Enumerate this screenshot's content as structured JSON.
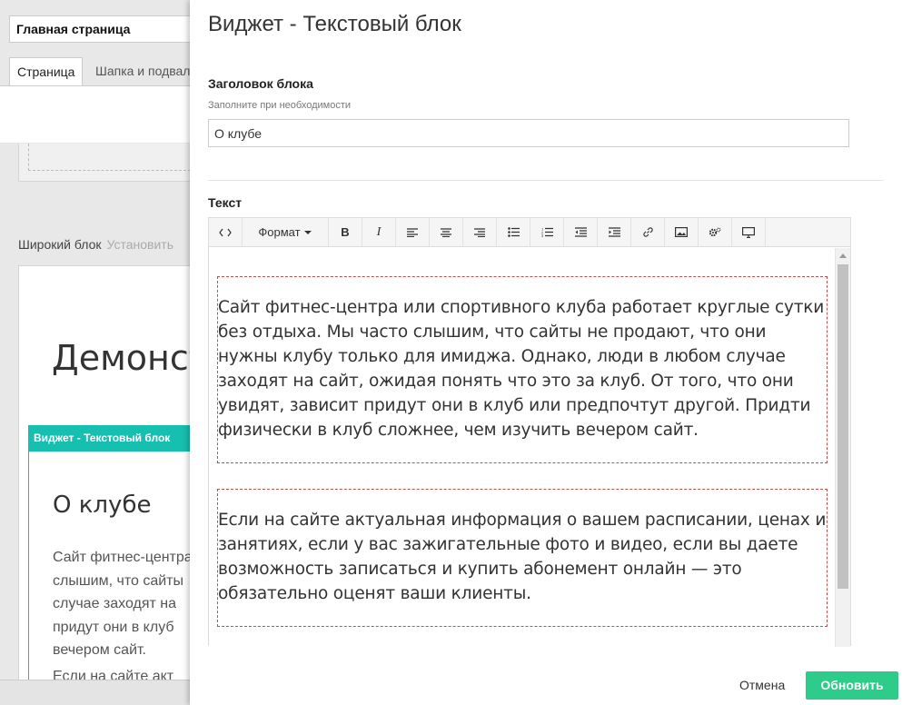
{
  "background": {
    "page_title": "Главная страница",
    "tabs": [
      {
        "label": "Страница"
      },
      {
        "label": "Шапка и подвал"
      }
    ],
    "wide_block": {
      "title": "Широкий блок",
      "hint": "Установить"
    },
    "demo_heading": "Демонстрация",
    "widget": {
      "header": "Виджет - Текстовый блок",
      "title": "О клубе",
      "text_lines": [
        "Сайт фитнес-центра",
        "слышим, что сайты",
        "случае заходят на",
        "придут они в клуб",
        "вечером сайт."
      ],
      "text2": "Если на сайте акт"
    }
  },
  "modal": {
    "title": "Виджет - Текстовый блок",
    "header_field": {
      "label": "Заголовок блока",
      "help": "Заполните при необходимости",
      "value": "О клубе"
    },
    "text_field": {
      "label": "Текст"
    },
    "toolbar": {
      "source_icon": "code-icon",
      "format_label": "Формат",
      "buttons": [
        "bold-icon",
        "italic-icon",
        "align-left-icon",
        "align-center-icon",
        "align-right-icon",
        "bullet-list-icon",
        "numbered-list-icon",
        "outdent-icon",
        "indent-icon",
        "link-icon",
        "image-icon",
        "settings-icon",
        "preview-icon"
      ]
    },
    "paragraphs": [
      "Сайт фитнес-центра или спортивного клуба работает круглые сутки без отдыха. Мы часто слышим, что сайты не продают, что они нужны клубу только для имиджа. Однако, люди в любом случае заходят на сайт, ожидая понять что это за клуб. От того, что они увидят, зависит придут они в клуб или предпочтут другой. Придти физически в клуб сложнее, чем изучить вечером сайт.",
      "Если на сайте актуальная информация о вашем расписании, ценах и занятиях, если у вас зажигательные фото и видео, если вы даете возможность записаться и купить абонемент онлайн — это обязательно оценят ваши клиенты."
    ],
    "cancel_label": "Отмена",
    "update_label": "Обновить",
    "accent_color": "#2ecc8a"
  }
}
